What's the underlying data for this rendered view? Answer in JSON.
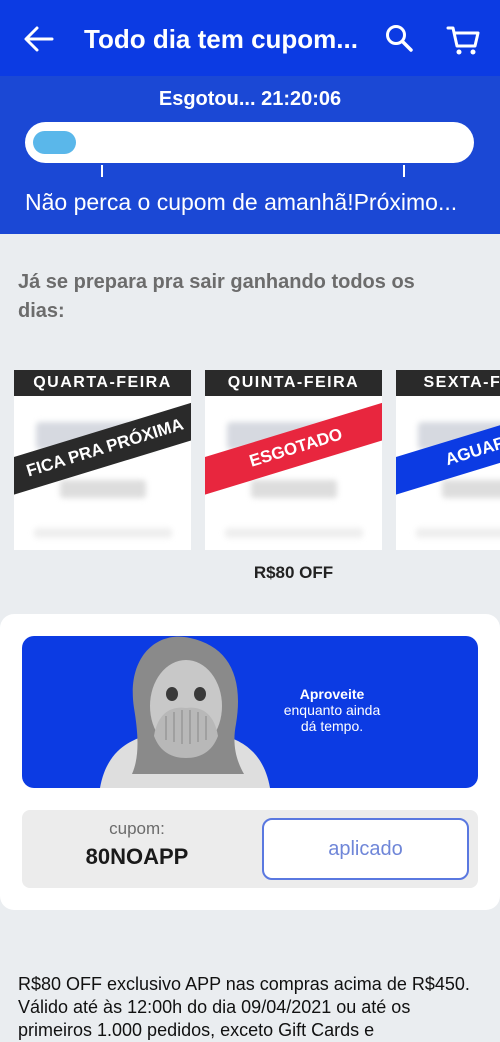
{
  "header": {
    "title": "Todo dia tem cupom...",
    "back_icon": "arrow-left-icon",
    "search_icon": "search-icon",
    "cart_icon": "cart-icon",
    "background": "#0c3be3"
  },
  "countdown": {
    "status_text": "Esgotou... 21:20:06",
    "progress_percent": 10,
    "message": "Não perca o cupom de amanhã!Próximo..."
  },
  "lead": "Já se prepara pra sair ganhando todos os dias:",
  "cards": [
    {
      "day": "QUARTA-FEIRA",
      "ribbon": "FICA PRA PRÓXIMA",
      "ribbon_color": "#2a2a2a"
    },
    {
      "day": "QUINTA-FEIRA",
      "ribbon": "ESGOTADO",
      "ribbon_color": "#e8263e"
    },
    {
      "day": "SEXTA-FEIRA",
      "ribbon": "AGUARDE",
      "ribbon_color": "#0c3be3"
    }
  ],
  "selected_card_value": "R$80 OFF",
  "promo": {
    "line1": "Aproveite",
    "line2": "enquanto ainda",
    "line3": "dá tempo."
  },
  "coupon": {
    "label": "cupom:",
    "code": "80NOAPP",
    "button": "aplicado"
  },
  "terms": "R$80 OFF exclusivo APP nas compras acima de R$450. Válido até às 12:00h do dia 09/04/2021 ou até os primeiros 1.000 pedidos, exceto Gift Cards e"
}
